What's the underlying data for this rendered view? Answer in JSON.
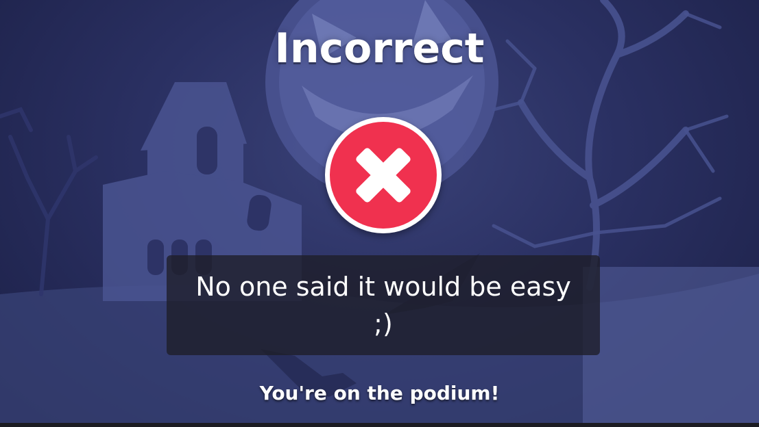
{
  "result": {
    "title": "Incorrect",
    "message": "No one said it would be easy ;)",
    "footer": "You're on the podium!"
  },
  "icons": {
    "result_icon": "cross-icon",
    "background_scene": "haunted-house-scene"
  },
  "colors": {
    "badge_red": "#f0314f",
    "badge_ring": "#ffffff",
    "background_dark": "#1b1f45",
    "background_mid": "#3a4278",
    "message_box": "#1e1e28"
  }
}
